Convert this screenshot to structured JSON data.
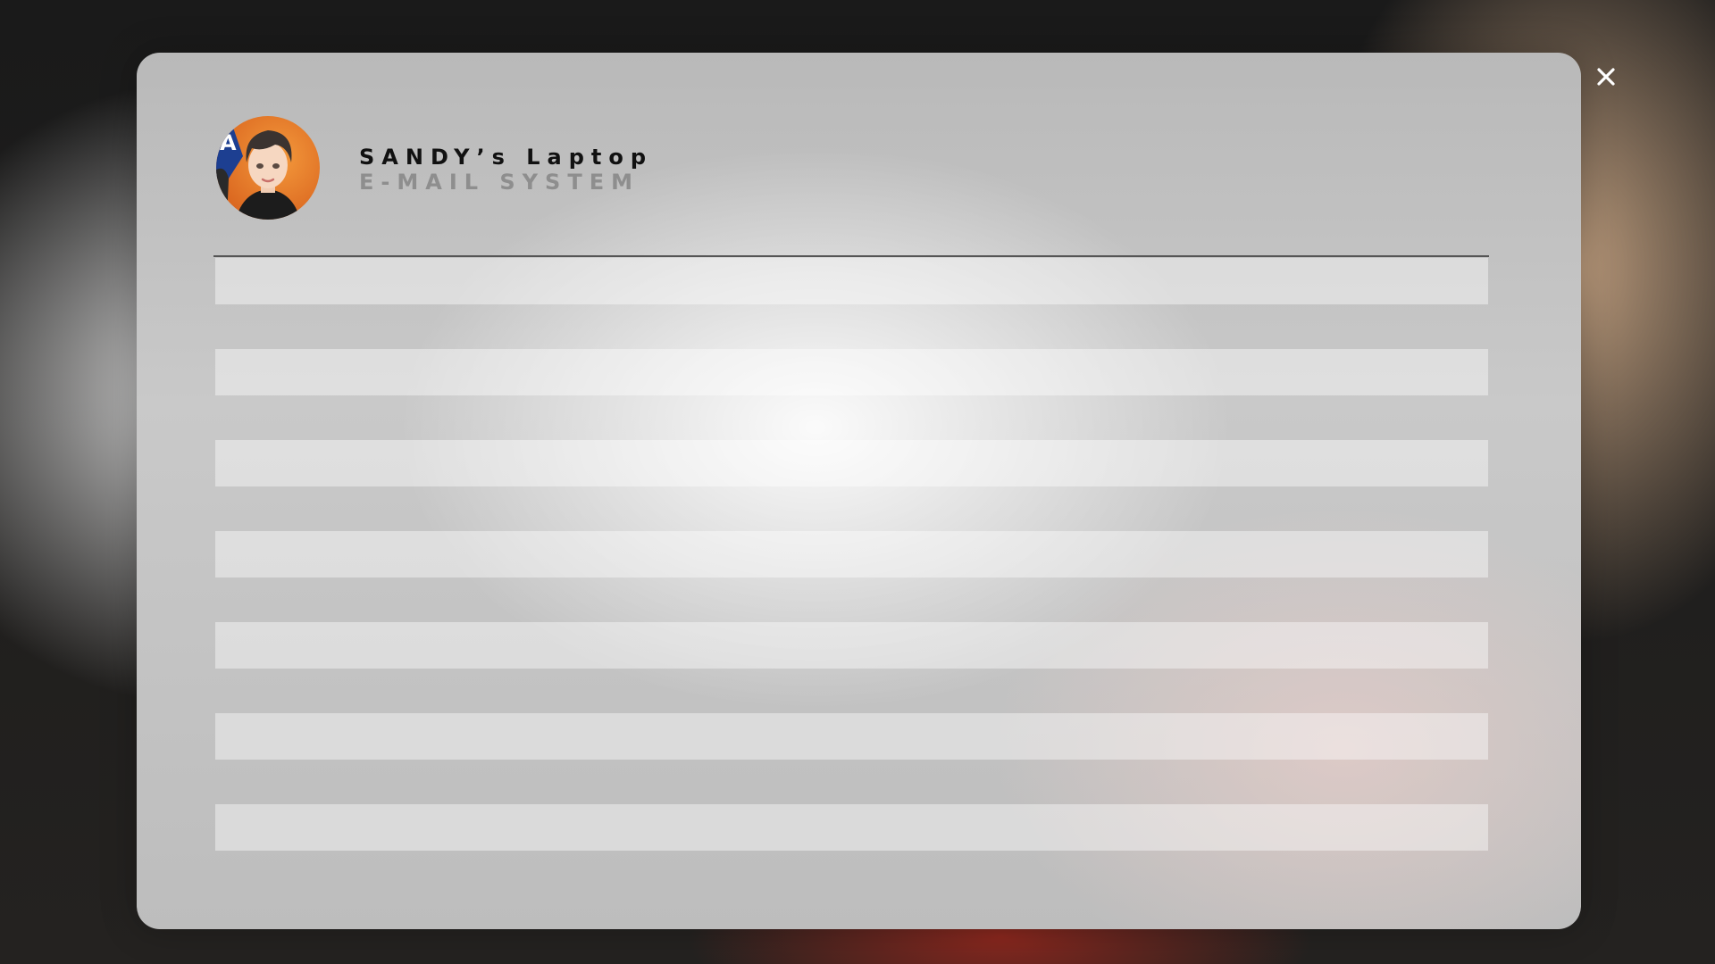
{
  "header": {
    "title": "SANDY’s Laptop",
    "subtitle": "E-MAIL SYSTEM"
  },
  "icons": {
    "close": "close-icon",
    "avatar": "user-avatar"
  },
  "email_list": {
    "row_count": 7
  },
  "colors": {
    "title": "#111111",
    "subtitle": "#8e8e8e",
    "divider": "#555555",
    "close_icon": "#ffffff",
    "avatar_bg": "#e8782a"
  }
}
